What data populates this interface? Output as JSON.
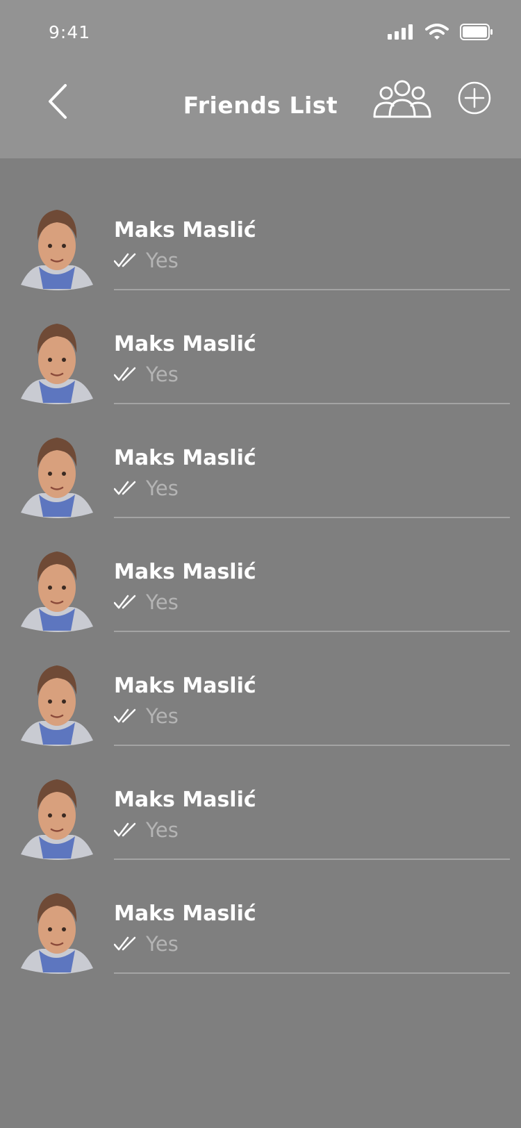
{
  "status_bar": {
    "time": "9:41"
  },
  "header": {
    "title": "Friends List",
    "back_icon": "chevron-left-icon",
    "group_icon": "group-icon",
    "add_icon": "plus-circle-icon"
  },
  "colors": {
    "header_bg": "#939393",
    "list_bg": "#7f7f7f",
    "text_primary": "#ffffff",
    "text_secondary": "#b4b4b4",
    "divider": "#a4a4a4"
  },
  "friends": [
    {
      "name": "Maks Maslić",
      "status": "Yes",
      "status_icon": "double-check-icon"
    },
    {
      "name": "Maks Maslić",
      "status": "Yes",
      "status_icon": "double-check-icon"
    },
    {
      "name": "Maks Maslić",
      "status": "Yes",
      "status_icon": "double-check-icon"
    },
    {
      "name": "Maks Maslić",
      "status": "Yes",
      "status_icon": "double-check-icon"
    },
    {
      "name": "Maks Maslić",
      "status": "Yes",
      "status_icon": "double-check-icon"
    },
    {
      "name": "Maks Maslić",
      "status": "Yes",
      "status_icon": "double-check-icon"
    },
    {
      "name": "Maks Maslić",
      "status": "Yes",
      "status_icon": "double-check-icon"
    }
  ]
}
